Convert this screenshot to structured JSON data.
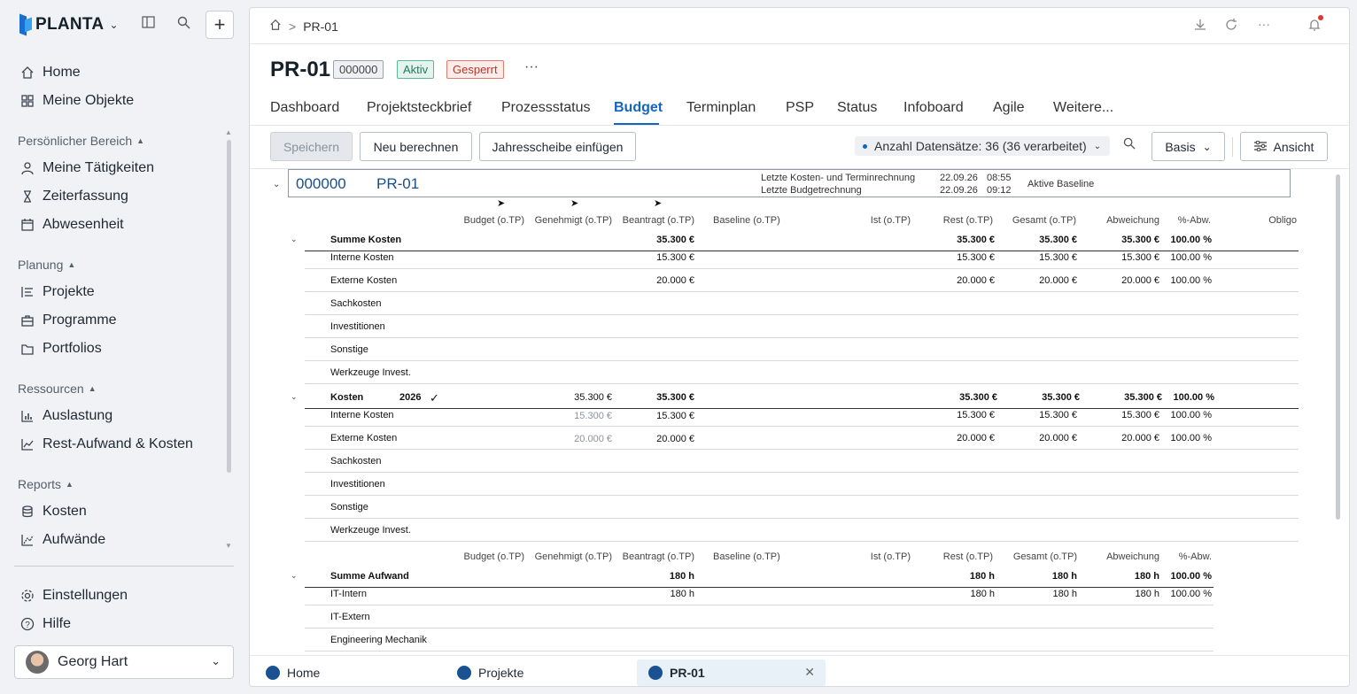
{
  "app": {
    "logo_text": "PLANTA",
    "nav_top": [
      {
        "label": "Home",
        "icon": "home-icon"
      },
      {
        "label": "Meine Objekte",
        "icon": "grid-icon"
      }
    ],
    "sections": [
      {
        "title": "Persönlicher Bereich",
        "items": [
          "Meine Tätigkeiten",
          "Zeiterfassung",
          "Abwesenheit"
        ]
      },
      {
        "title": "Planung",
        "items": [
          "Projekte",
          "Programme",
          "Portfolios"
        ]
      },
      {
        "title": "Ressourcen",
        "items": [
          "Auslastung",
          "Rest-Aufwand & Kosten"
        ]
      },
      {
        "title": "Reports",
        "items": [
          "Kosten",
          "Aufwände"
        ]
      }
    ],
    "nav_bottom": [
      "Einstellungen",
      "Hilfe"
    ],
    "user": "Georg Hart"
  },
  "page": {
    "breadcrumb": "PR-01",
    "title": "PR-01",
    "badges": [
      "000000",
      "Aktiv",
      "Gesperrt"
    ],
    "more": "···",
    "tabs": [
      "Dashboard",
      "Projektsteckbrief",
      "Prozessstatus",
      "Budget",
      "Terminplan",
      "PSP",
      "Status",
      "Infoboard",
      "Agile",
      "Weitere..."
    ],
    "active_tab": "Budget"
  },
  "toolbar": {
    "save": "Speichern",
    "recalc": "Neu berechnen",
    "insert_year": "Jahresscheibe einfügen",
    "records": "Anzahl Datensätze: 36 (36 verarbeitet)",
    "view_basis": "Basis",
    "view": "Ansicht"
  },
  "project": {
    "code": "000000",
    "name": "PR-01",
    "last_cost_label": "Letzte Kosten- und Terminrechnung",
    "last_cost_date": "22.09.26",
    "last_cost_time": "08:55",
    "last_budget_label": "Letzte Budgetrechnung",
    "last_budget_date": "22.09.26",
    "last_budget_time": "09:12",
    "baseline_label": "Aktive Baseline"
  },
  "columns": [
    "Budget (o.TP)",
    "Genehmigt (o.TP)",
    "Beantragt (o.TP)",
    "Baseline (o.TP)",
    "Ist (o.TP)",
    "Rest (o.TP)",
    "Gesamt (o.TP)",
    "Abweichung",
    "%-Abw.",
    "Obligo"
  ],
  "summe_kosten": {
    "label": "Summe Kosten",
    "beantragt": "35.300 €",
    "rest": "35.300 €",
    "gesamt": "35.300 €",
    "abweichung": "35.300 €",
    "pct": "100.00 %",
    "rows": [
      {
        "label": "Interne Kosten",
        "beantragt": "15.300 €",
        "rest": "15.300 €",
        "gesamt": "15.300 €",
        "abweichung": "15.300 €",
        "pct": "100.00 %"
      },
      {
        "label": "Externe Kosten",
        "beantragt": "20.000 €",
        "rest": "20.000 €",
        "gesamt": "20.000 €",
        "abweichung": "20.000 €",
        "pct": "100.00 %"
      },
      {
        "label": "Sachkosten"
      },
      {
        "label": "Investitionen"
      },
      {
        "label": "Sonstige"
      },
      {
        "label": "Werkzeuge Invest."
      }
    ]
  },
  "kosten_2026": {
    "label": "Kosten",
    "year": "2026",
    "check": "✓",
    "genehmigt": "35.300 €",
    "beantragt": "35.300 €",
    "rest": "35.300 €",
    "gesamt": "35.300 €",
    "abweichung": "35.300 €",
    "pct": "100.00 %",
    "rows": [
      {
        "label": "Interne Kosten",
        "genehmigt": "15.300 €",
        "beantragt": "15.300 €",
        "rest": "15.300 €",
        "gesamt": "15.300 €",
        "abweichung": "15.300 €",
        "pct": "100.00 %"
      },
      {
        "label": "Externe Kosten",
        "genehmigt": "20.000 €",
        "beantragt": "20.000 €",
        "rest": "20.000 €",
        "gesamt": "20.000 €",
        "abweichung": "20.000 €",
        "pct": "100.00 %"
      },
      {
        "label": "Sachkosten"
      },
      {
        "label": "Investitionen"
      },
      {
        "label": "Sonstige"
      },
      {
        "label": "Werkzeuge Invest."
      }
    ]
  },
  "summe_aufwand": {
    "label": "Summe Aufwand",
    "beantragt": "180 h",
    "rest": "180 h",
    "gesamt": "180 h",
    "abweichung": "180 h",
    "pct": "100.00 %",
    "rows": [
      {
        "label": "IT-Intern",
        "beantragt": "180 h",
        "rest": "180 h",
        "gesamt": "180 h",
        "abweichung": "180 h",
        "pct": "100.00 %"
      },
      {
        "label": "IT-Extern"
      },
      {
        "label": "Engineering Mechanik"
      }
    ]
  },
  "bottom_tabs": [
    "Home",
    "Projekte",
    "PR-01"
  ],
  "colors": {
    "accent": "#1565c0",
    "active_green": "#237a5d",
    "locked_red": "#b8392a"
  }
}
